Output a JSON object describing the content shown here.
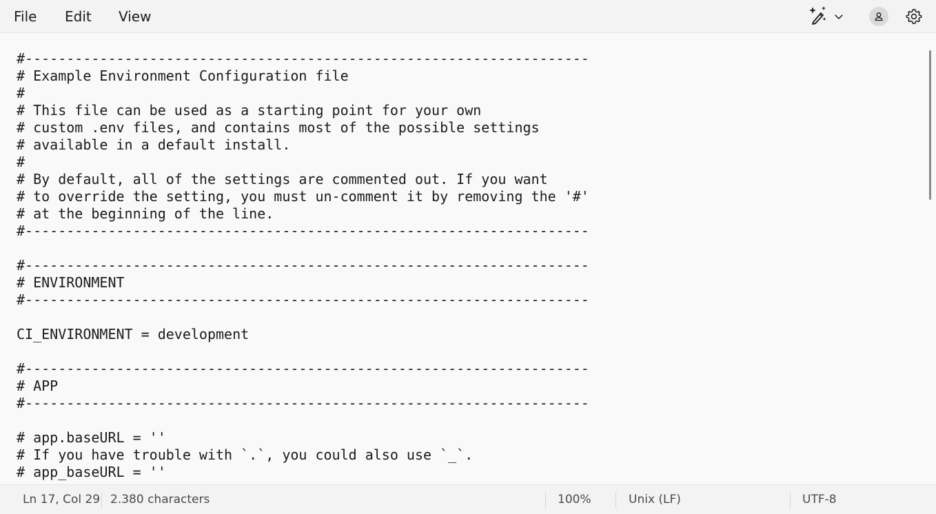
{
  "menu": {
    "file": "File",
    "edit": "Edit",
    "view": "View"
  },
  "toolbar": {
    "copilot_icon": "copilot-sparkle-pen-icon",
    "dropdown_icon": "chevron-down-icon",
    "account_icon": "account-icon",
    "settings_icon": "gear-icon"
  },
  "editor": {
    "lines": [
      "#--------------------------------------------------------------------",
      "# Example Environment Configuration file",
      "#",
      "# This file can be used as a starting point for your own",
      "# custom .env files, and contains most of the possible settings",
      "# available in a default install.",
      "#",
      "# By default, all of the settings are commented out. If you want",
      "# to override the setting, you must un-comment it by removing the '#'",
      "# at the beginning of the line.",
      "#--------------------------------------------------------------------",
      "",
      "#--------------------------------------------------------------------",
      "# ENVIRONMENT",
      "#--------------------------------------------------------------------",
      "",
      "CI_ENVIRONMENT = development",
      "",
      "#--------------------------------------------------------------------",
      "# APP",
      "#--------------------------------------------------------------------",
      "",
      "# app.baseURL = ''",
      "# If you have trouble with `.`, you could also use `_`.",
      "# app_baseURL = ''"
    ]
  },
  "status": {
    "position": "Ln 17, Col 29",
    "characters": "2.380 characters",
    "zoom": "100%",
    "line_ending": "Unix (LF)",
    "encoding": "UTF-8"
  },
  "colors": {
    "background": "#f9f9f9",
    "chrome": "#f3f3f3",
    "text": "#1b1b1b"
  }
}
